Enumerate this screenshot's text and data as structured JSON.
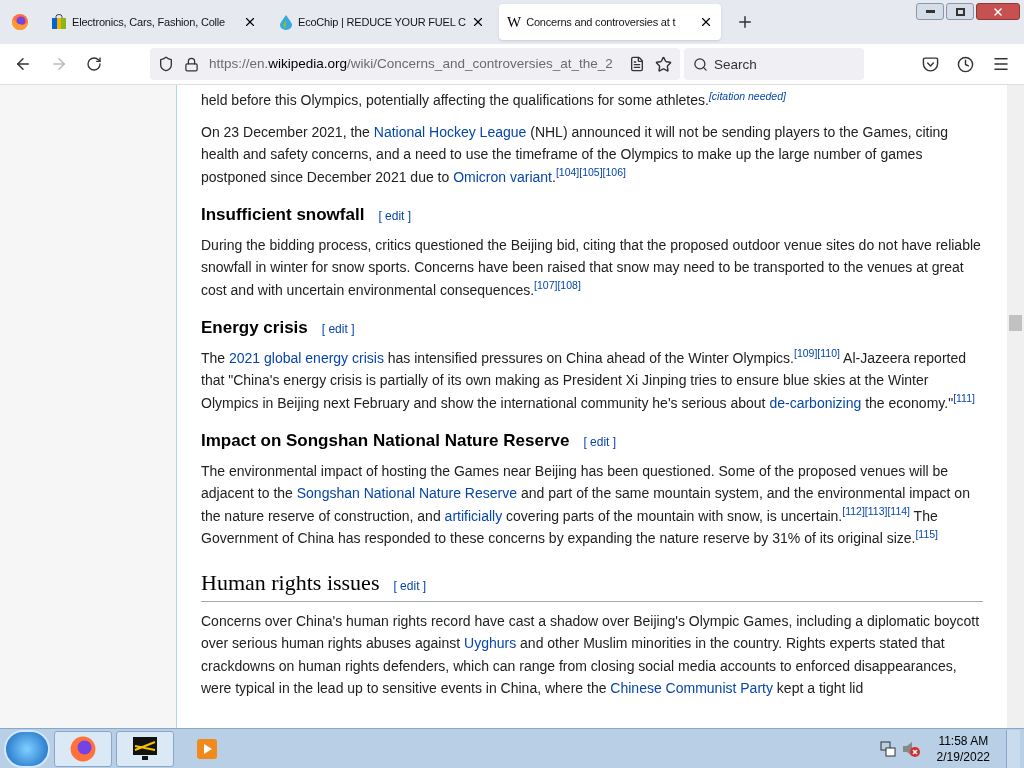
{
  "tabs": [
    {
      "title": "Electronics, Cars, Fashion, Colle",
      "selected": false
    },
    {
      "title": "EcoChip | REDUCE YOUR FUEL C",
      "selected": false
    },
    {
      "title": "Concerns and controversies at t",
      "selected": true,
      "logo": "W"
    }
  ],
  "address": {
    "prefix": "https://en.",
    "domain": "wikipedia.org",
    "path": "/wiki/Concerns_and_controversies_at_the_2"
  },
  "search": {
    "placeholder": "Search"
  },
  "article": [
    {
      "kind": "paragraph",
      "segments": [
        {
          "kind": "text",
          "text": "held before this Olympics, potentially affecting the qualifications for some athletes."
        },
        {
          "kind": "ref",
          "text": "[citation needed]",
          "italic": true
        }
      ]
    },
    {
      "kind": "paragraph",
      "segments": [
        {
          "kind": "text",
          "text": "On 23 December 2021, the "
        },
        {
          "kind": "link",
          "text": "National Hockey League"
        },
        {
          "kind": "text",
          "text": " (NHL) announced it will not be sending players to the Games, citing health and safety concerns, and a need to use the timeframe of the Olympics to make up the large number of games postponed since December 2021 due to "
        },
        {
          "kind": "link",
          "text": "Omicron variant"
        },
        {
          "kind": "text",
          "text": "."
        },
        {
          "kind": "ref",
          "text": "[104][105][106]"
        }
      ]
    },
    {
      "kind": "h3",
      "title": "Insufficient snowfall",
      "edit": "[ edit ]"
    },
    {
      "kind": "paragraph",
      "segments": [
        {
          "kind": "text",
          "text": "During the bidding process, critics questioned the Beijing bid, citing that the proposed outdoor venue sites do not have reliable snowfall in winter for snow sports. Concerns have been raised that snow may need to be transported to the venues at great cost and with uncertain environmental consequences."
        },
        {
          "kind": "ref",
          "text": "[107][108]"
        }
      ]
    },
    {
      "kind": "h3",
      "title": "Energy crisis",
      "edit": "[ edit ]"
    },
    {
      "kind": "paragraph",
      "segments": [
        {
          "kind": "text",
          "text": "The "
        },
        {
          "kind": "link",
          "text": "2021 global energy crisis"
        },
        {
          "kind": "text",
          "text": " has intensified pressures on China ahead of the Winter Olympics."
        },
        {
          "kind": "ref",
          "text": "[109][110]"
        },
        {
          "kind": "text",
          "text": " Al-Jazeera reported that \"China's energy crisis is partially of its own making as President Xi Jinping tries to ensure blue skies at the Winter Olympics in Beijing next February and show the international community he's serious about "
        },
        {
          "kind": "link",
          "text": "de-carbonizing"
        },
        {
          "kind": "text",
          "text": " the economy.\""
        },
        {
          "kind": "ref",
          "text": "[111]"
        }
      ]
    },
    {
      "kind": "h3",
      "title": "Impact on Songshan National Nature Reserve",
      "edit": "[ edit ]"
    },
    {
      "kind": "paragraph",
      "segments": [
        {
          "kind": "text",
          "text": "The environmental impact of hosting the Games near Beijing has been questioned. Some of the proposed venues will be adjacent to the "
        },
        {
          "kind": "link",
          "text": "Songshan National Nature Reserve"
        },
        {
          "kind": "text",
          "text": " and part of the same mountain system, and the environmental impact on the nature reserve of construction, and "
        },
        {
          "kind": "link",
          "text": "artificially"
        },
        {
          "kind": "text",
          "text": " covering parts of the mountain with snow, is uncertain."
        },
        {
          "kind": "ref",
          "text": "[112][113][114]"
        },
        {
          "kind": "text",
          "text": " The Government of China has responded to these concerns by expanding the nature reserve by 31% of its original size."
        },
        {
          "kind": "ref",
          "text": "[115]"
        }
      ]
    },
    {
      "kind": "h2",
      "title": "Human rights issues",
      "edit": "[ edit ]"
    },
    {
      "kind": "paragraph",
      "segments": [
        {
          "kind": "text",
          "text": "Concerns over China's human rights record have cast a shadow over Beijing's Olympic Games, including a diplomatic boycott over serious human rights abuses against "
        },
        {
          "kind": "link",
          "text": "Uyghurs"
        },
        {
          "kind": "text",
          "text": " and other Muslim minorities in the country. Rights experts stated that crackdowns on human rights defenders, which can range from closing social media accounts to enforced disappearances, were typical in the lead up to sensitive events in China, where the "
        },
        {
          "kind": "link",
          "text": "Chinese Communist Party"
        },
        {
          "kind": "text",
          "text": " kept a tight lid"
        }
      ]
    }
  ],
  "clock": {
    "time": "11:58 AM",
    "date": "2/19/2022"
  }
}
